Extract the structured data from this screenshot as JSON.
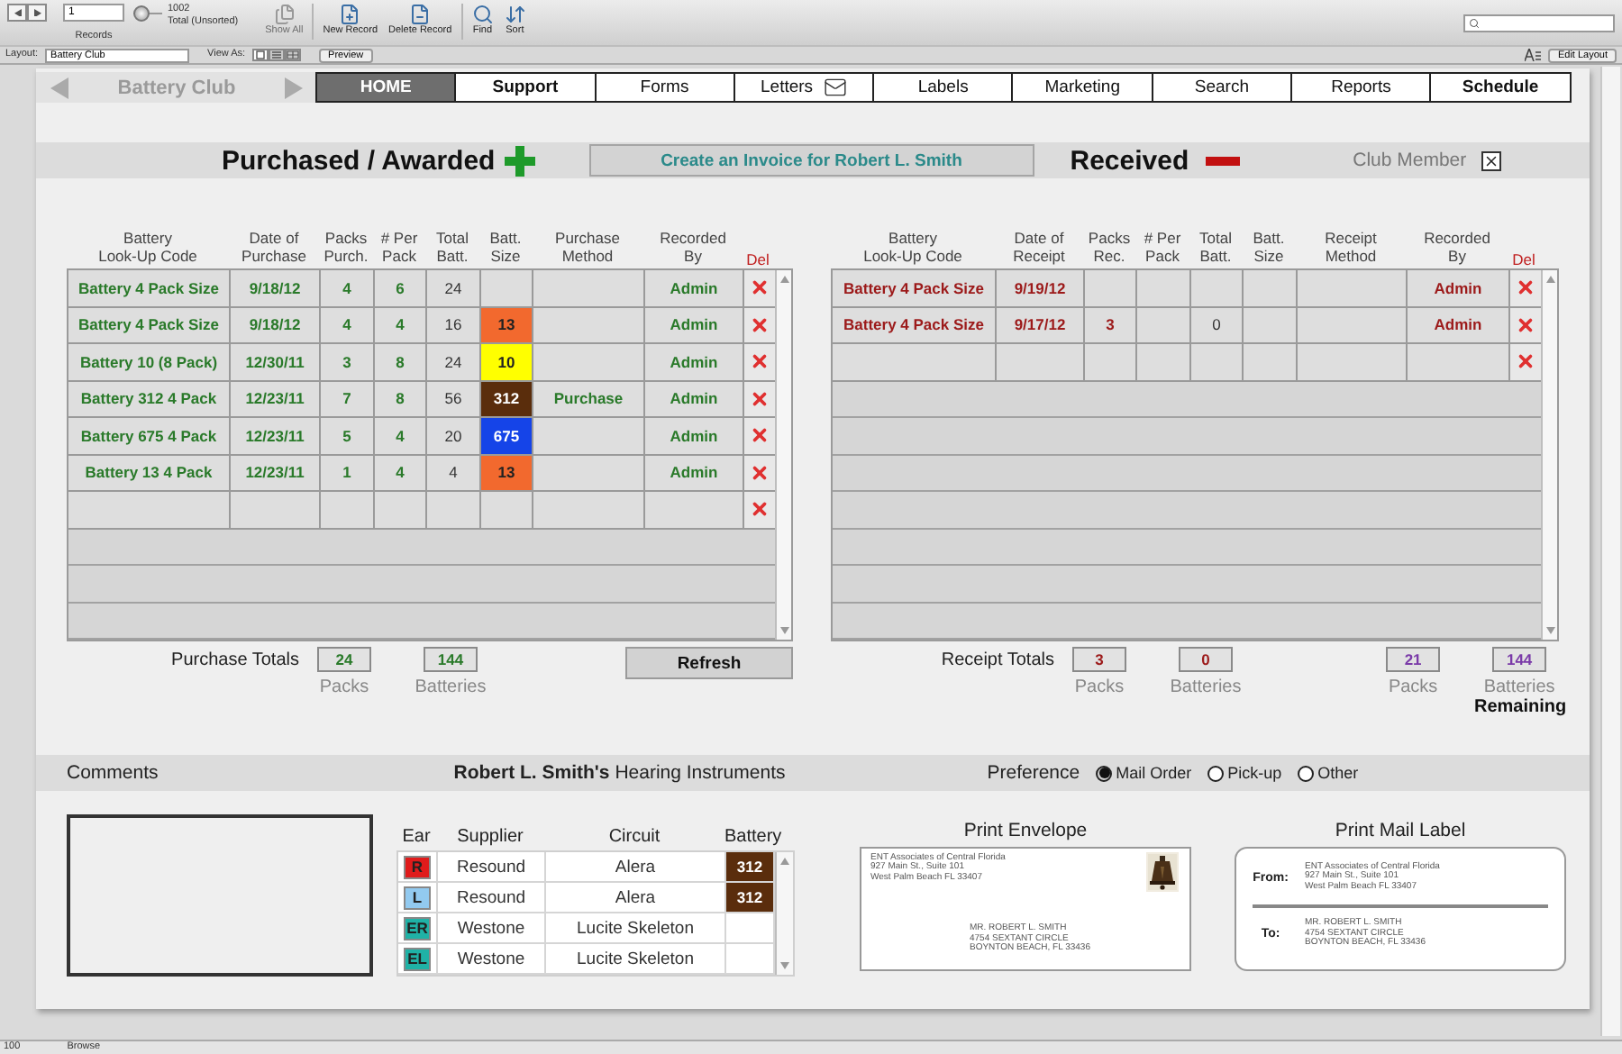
{
  "toolbar": {
    "record": "1",
    "records_label": "Records",
    "found": "1002",
    "sort_status": "Total (Unsorted)",
    "slider": {
      "level": 0
    },
    "buttons": [
      {
        "label": "Show All",
        "kind": "show_all",
        "disabled": true
      },
      {
        "label": "New Record",
        "kind": "new",
        "disabled": false
      },
      {
        "label": "Delete Record",
        "kind": "delete",
        "disabled": false
      },
      {
        "label": "Find",
        "kind": "find",
        "disabled": false
      },
      {
        "label": "Sort",
        "kind": "sort",
        "disabled": false
      }
    ]
  },
  "layout_bar": {
    "layout_label": "Layout:",
    "layout": "Battery Club",
    "view_as_label": "View As:",
    "view_modes": [
      {
        "kind": "form",
        "selected": true
      },
      {
        "kind": "list",
        "selected": false
      },
      {
        "kind": "table",
        "selected": false
      }
    ],
    "preview": "Preview",
    "edit_layout": "Edit Layout"
  },
  "nav": {
    "title": "Battery Club",
    "tabs": [
      {
        "label": "HOME",
        "selected": true,
        "emphasized": false,
        "kind": "plain"
      },
      {
        "label": "Support",
        "selected": false,
        "emphasized": true,
        "kind": "plain"
      },
      {
        "label": "Forms",
        "selected": false,
        "emphasized": false,
        "kind": "plain"
      },
      {
        "label": "Letters",
        "selected": false,
        "emphasized": false,
        "kind": "mail"
      },
      {
        "label": "Labels",
        "selected": false,
        "emphasized": false,
        "kind": "plain"
      },
      {
        "label": "Marketing",
        "selected": false,
        "emphasized": false,
        "kind": "plain"
      },
      {
        "label": "Search",
        "selected": false,
        "emphasized": false,
        "kind": "plain"
      },
      {
        "label": "Reports",
        "selected": false,
        "emphasized": false,
        "kind": "plain"
      },
      {
        "label": "Schedule",
        "selected": false,
        "emphasized": true,
        "kind": "plain"
      }
    ]
  },
  "purchases": {
    "title": "Purchased / Awarded",
    "invoice_button": "Create an Invoice for Robert L. Smith",
    "del_label": "Del",
    "columns": [
      "Battery\nLook-Up Code",
      "Date of\nPurchase",
      "Packs\nPurch.",
      "# Per\nPack",
      "Total\nBatt.",
      "Batt.\nSize",
      "Purchase\nMethod",
      "Recorded\nBy"
    ],
    "rows": [
      {
        "code": "Battery 4 Pack Size",
        "date": "9/18/12",
        "packs": "4",
        "per_pack": "6",
        "total": "24",
        "recorded_by": "Admin"
      },
      {
        "code": "Battery 4 Pack Size",
        "date": "9/18/12",
        "packs": "4",
        "per_pack": "4",
        "total": "16",
        "size": {
          "label": "13",
          "color": "#f2692e"
        },
        "recorded_by": "Admin"
      },
      {
        "code": "Battery 10 (8 Pack)",
        "date": "12/30/11",
        "packs": "3",
        "per_pack": "8",
        "total": "24",
        "size": {
          "label": "10",
          "color": "#ffff00"
        },
        "recorded_by": "Admin"
      },
      {
        "code": "Battery 312 4 Pack",
        "date": "12/23/11",
        "packs": "7",
        "per_pack": "8",
        "total": "56",
        "size": {
          "label": "312",
          "color": "#5a2d0c"
        },
        "method": "Purchase",
        "recorded_by": "Admin"
      },
      {
        "code": "Battery 675 4 Pack",
        "date": "12/23/11",
        "packs": "5",
        "per_pack": "4",
        "total": "20",
        "size": {
          "label": "675",
          "color": "#1544e8"
        },
        "recorded_by": "Admin"
      },
      {
        "code": "Battery 13 4 Pack",
        "date": "12/23/11",
        "packs": "1",
        "per_pack": "4",
        "total": "4",
        "size": {
          "label": "13",
          "color": "#f2692e"
        },
        "recorded_by": "Admin"
      }
    ],
    "totals_label": "Purchase Totals",
    "totals": [
      {
        "value": "24",
        "label": "Packs"
      },
      {
        "value": "144",
        "label": "Batteries"
      }
    ],
    "refresh_button": "Refresh"
  },
  "receipts": {
    "title": "Received",
    "del_label": "Del",
    "columns": [
      "Battery\nLook-Up Code",
      "Date of\nReceipt",
      "Packs\nRec.",
      "# Per\nPack",
      "Total\nBatt.",
      "Batt.\nSize",
      "Receipt\nMethod",
      "Recorded\nBy"
    ],
    "rows": [
      {
        "code": "Battery 4 Pack Size",
        "date": "9/19/12",
        "recorded_by": "Admin"
      },
      {
        "code": "Battery 4 Pack Size",
        "date": "9/17/12",
        "packs": "3",
        "total": "0",
        "recorded_by": "Admin"
      }
    ],
    "totals_label": "Receipt Totals",
    "totals": [
      {
        "value": "3",
        "label": "Packs"
      },
      {
        "value": "0",
        "label": "Batteries"
      }
    ],
    "remaining": [
      {
        "value": "21",
        "label": "Packs"
      },
      {
        "value": "144",
        "label": "Batteries"
      }
    ],
    "remaining_label": "Remaining"
  },
  "club_member": {
    "label": "Club Member",
    "checked": true
  },
  "comments": {
    "label": "Comments"
  },
  "instruments": {
    "title": "**Robert L. Smith's** Hearing Instruments",
    "columns": [
      "Ear",
      "Supplier",
      "Circuit",
      "Battery"
    ],
    "rows": [
      {
        "ear": "R",
        "color": "#e01b1b",
        "supplier": "Resound",
        "circuit": "Alera",
        "battery": {
          "label": "312",
          "color": "#5a2d0c"
        }
      },
      {
        "ear": "L",
        "color": "#92caf0",
        "supplier": "Resound",
        "circuit": "Alera",
        "battery": {
          "label": "312",
          "color": "#5a2d0c"
        }
      },
      {
        "ear": "ER",
        "color": "#1fb2a6",
        "supplier": "Westone",
        "circuit": "Lucite Skeleton"
      },
      {
        "ear": "EL",
        "color": "#1fb2a6",
        "supplier": "Westone",
        "circuit": "Lucite Skeleton"
      }
    ]
  },
  "preference": {
    "label": "Preference",
    "options": [
      {
        "label": "Mail Order",
        "selected": true
      },
      {
        "label": "Pick-up",
        "selected": false
      },
      {
        "label": "Other",
        "selected": false
      }
    ]
  },
  "envelope": {
    "title": "Print Envelope",
    "sender": [
      "ENT Associates of Central Florida",
      "927 Main St., Suite 101",
      "West Palm Beach FL 33407"
    ],
    "recipient": [
      "MR. ROBERT L. SMITH",
      "4754 SEXTANT CIRCLE",
      "BOYNTON BEACH, FL 33436"
    ]
  },
  "mail_label": {
    "title": "Print Mail Label",
    "from_label": "From:",
    "from": [
      "ENT Associates of Central Florida",
      "927 Main St., Suite 101",
      "West Palm Beach FL 33407"
    ],
    "to_label": "To:",
    "to": [
      "MR. ROBERT L. SMITH",
      "4754 SEXTANT CIRCLE",
      "BOYNTON BEACH, FL 33436"
    ]
  },
  "status_bar": {
    "zoom": "100",
    "mode": "Browse"
  }
}
